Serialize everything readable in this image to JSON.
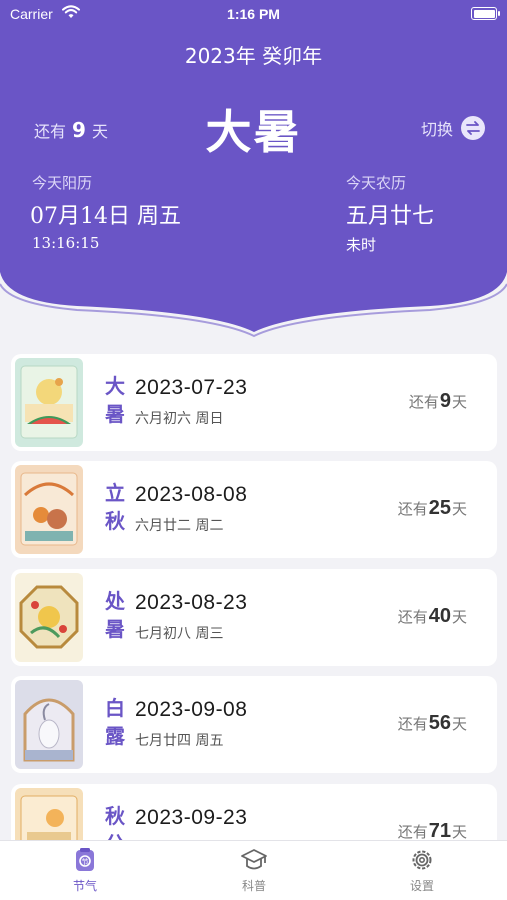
{
  "status_bar": {
    "carrier": "Carrier",
    "time": "1:16 PM"
  },
  "header": {
    "year_title": "2023年 癸卯年",
    "remain_prefix": "还有",
    "remain_days": "9",
    "remain_suffix": "天",
    "current_term": "大暑",
    "switch_label": "切换",
    "solar_label": "今天阳历",
    "solar_date": "07月14日 周五",
    "solar_time": "13:16:15",
    "lunar_label": "今天农历",
    "lunar_date": "五月廿七",
    "lunar_hour": "未时"
  },
  "terms": [
    {
      "char1": "大",
      "char2": "暑",
      "date": "2023-07-23",
      "lunar": "六月初六 周日",
      "remain_prefix": "还有",
      "days": "9",
      "remain_suffix": "天",
      "thumb": "summer-watermelon-illustration"
    },
    {
      "char1": "立",
      "char2": "秋",
      "date": "2023-08-08",
      "lunar": "六月廿二 周二",
      "remain_prefix": "还有",
      "days": "25",
      "remain_suffix": "天",
      "thumb": "autumn-persimmon-illustration"
    },
    {
      "char1": "处",
      "char2": "暑",
      "date": "2023-08-23",
      "lunar": "七月初八 周三",
      "remain_prefix": "还有",
      "days": "40",
      "remain_suffix": "天",
      "thumb": "octagon-window-illustration"
    },
    {
      "char1": "白",
      "char2": "露",
      "date": "2023-09-08",
      "lunar": "七月廿四 周五",
      "remain_prefix": "还有",
      "days": "56",
      "remain_suffix": "天",
      "thumb": "crane-arch-illustration"
    },
    {
      "char1": "秋",
      "char2": "分",
      "date": "2023-09-23",
      "lunar": "",
      "remain_prefix": "还有",
      "days": "71",
      "remain_suffix": "天",
      "thumb": "autumn-equinox-illustration"
    }
  ],
  "tabs": [
    {
      "label": "节气",
      "icon": "solar-term-icon",
      "active": true
    },
    {
      "label": "科普",
      "icon": "graduation-cap-icon",
      "active": false
    },
    {
      "label": "设置",
      "icon": "gear-icon",
      "active": false
    }
  ],
  "colors": {
    "primary": "#6a55c6",
    "background": "#f2f2f6"
  }
}
